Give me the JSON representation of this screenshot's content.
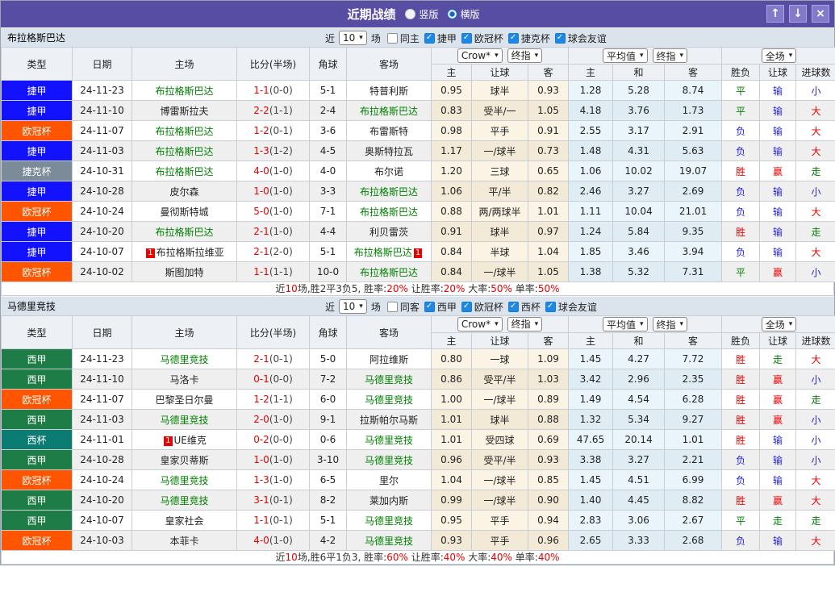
{
  "titlebar": {
    "title": "近期战绩",
    "radios": [
      {
        "label": "竖版",
        "selected": false
      },
      {
        "label": "横版",
        "selected": true
      }
    ],
    "buttons": {
      "up": "↑",
      "down": "↓",
      "close": "×"
    }
  },
  "colors": {
    "accent": "#574da3",
    "leagues": {
      "捷甲": "#1212ff",
      "欧冠杯": "#ff5400",
      "捷克杯": "#7c8b99",
      "西甲": "#1e7c46",
      "西杯": "#0b7c72"
    },
    "words": {
      "胜": "#ee0000",
      "赢": "#ee0000",
      "大": "#ee0000",
      "平": "#008000",
      "走": "#008000",
      "负": "#2222dd",
      "输": "#2222dd",
      "小": "#2222dd"
    }
  },
  "sections": [
    {
      "team": "布拉格斯巴达",
      "filter": {
        "near_label": "近",
        "count": "10",
        "matches_label": "场",
        "same": {
          "label": "同主",
          "checked": false
        },
        "leagues": [
          {
            "label": "捷甲",
            "checked": true
          },
          {
            "label": "欧冠杯",
            "checked": true
          },
          {
            "label": "捷克杯",
            "checked": true
          },
          {
            "label": "球会友谊",
            "checked": true
          }
        ]
      },
      "selects": {
        "book": "Crow*",
        "book_ref": "终指",
        "avg": "平均值",
        "avg_ref": "终指",
        "full": "全场"
      },
      "headers": [
        "类型",
        "日期",
        "主场",
        "比分(半场)",
        "角球",
        "客场"
      ],
      "sub_headers": [
        "主",
        "让球",
        "客",
        "主",
        "和",
        "客",
        "胜负",
        "让球",
        "进球数"
      ],
      "rows": [
        {
          "league": "捷甲",
          "date": "24-11-23",
          "home": "布拉格斯巴达",
          "home_hl": true,
          "home_rc": 0,
          "ft": "1-1",
          "ht": "(0-0)",
          "corner": "5-1",
          "away": "特普利斯",
          "away_hl": false,
          "away_rc": 0,
          "hcap": [
            "0.95",
            "球半",
            "0.93"
          ],
          "avg": [
            "1.28",
            "5.28",
            "8.74"
          ],
          "result": [
            "平",
            "输",
            "小"
          ]
        },
        {
          "league": "捷甲",
          "date": "24-11-10",
          "home": "博雷斯拉夫",
          "home_hl": false,
          "home_rc": 0,
          "ft": "2-2",
          "ht": "(1-1)",
          "corner": "2-4",
          "away": "布拉格斯巴达",
          "away_hl": true,
          "away_rc": 0,
          "hcap": [
            "0.83",
            "受半/一",
            "1.05"
          ],
          "avg": [
            "4.18",
            "3.76",
            "1.73"
          ],
          "result": [
            "平",
            "输",
            "大"
          ]
        },
        {
          "league": "欧冠杯",
          "date": "24-11-07",
          "home": "布拉格斯巴达",
          "home_hl": true,
          "home_rc": 0,
          "ft": "1-2",
          "ht": "(0-1)",
          "corner": "3-6",
          "away": "布雷斯特",
          "away_hl": false,
          "away_rc": 0,
          "hcap": [
            "0.98",
            "平手",
            "0.91"
          ],
          "avg": [
            "2.55",
            "3.17",
            "2.91"
          ],
          "result": [
            "负",
            "输",
            "大"
          ]
        },
        {
          "league": "捷甲",
          "date": "24-11-03",
          "home": "布拉格斯巴达",
          "home_hl": true,
          "home_rc": 0,
          "ft": "1-3",
          "ht": "(1-2)",
          "corner": "4-5",
          "away": "奥斯特拉瓦",
          "away_hl": false,
          "away_rc": 0,
          "hcap": [
            "1.17",
            "一/球半",
            "0.73"
          ],
          "avg": [
            "1.48",
            "4.31",
            "5.63"
          ],
          "result": [
            "负",
            "输",
            "大"
          ]
        },
        {
          "league": "捷克杯",
          "date": "24-10-31",
          "home": "布拉格斯巴达",
          "home_hl": true,
          "home_rc": 0,
          "ft": "4-0",
          "ht": "(1-0)",
          "corner": "4-0",
          "away": "布尔诺",
          "away_hl": false,
          "away_rc": 0,
          "hcap": [
            "1.20",
            "三球",
            "0.65"
          ],
          "avg": [
            "1.06",
            "10.02",
            "19.07"
          ],
          "result": [
            "胜",
            "赢",
            "走"
          ]
        },
        {
          "league": "捷甲",
          "date": "24-10-28",
          "home": "皮尔森",
          "home_hl": false,
          "home_rc": 0,
          "ft": "1-0",
          "ht": "(1-0)",
          "corner": "3-3",
          "away": "布拉格斯巴达",
          "away_hl": true,
          "away_rc": 0,
          "hcap": [
            "1.06",
            "平/半",
            "0.82"
          ],
          "avg": [
            "2.46",
            "3.27",
            "2.69"
          ],
          "result": [
            "负",
            "输",
            "小"
          ]
        },
        {
          "league": "欧冠杯",
          "date": "24-10-24",
          "home": "曼彻斯特城",
          "home_hl": false,
          "home_rc": 0,
          "ft": "5-0",
          "ht": "(1-0)",
          "corner": "7-1",
          "away": "布拉格斯巴达",
          "away_hl": true,
          "away_rc": 0,
          "hcap": [
            "0.88",
            "两/两球半",
            "1.01"
          ],
          "avg": [
            "1.11",
            "10.04",
            "21.01"
          ],
          "result": [
            "负",
            "输",
            "大"
          ]
        },
        {
          "league": "捷甲",
          "date": "24-10-20",
          "home": "布拉格斯巴达",
          "home_hl": true,
          "home_rc": 0,
          "ft": "2-1",
          "ht": "(1-0)",
          "corner": "4-4",
          "away": "利贝雷茨",
          "away_hl": false,
          "away_rc": 0,
          "hcap": [
            "0.91",
            "球半",
            "0.97"
          ],
          "avg": [
            "1.24",
            "5.84",
            "9.35"
          ],
          "result": [
            "胜",
            "输",
            "走"
          ]
        },
        {
          "league": "捷甲",
          "date": "24-10-07",
          "home": "布拉格斯拉维亚",
          "home_hl": false,
          "home_rc": 1,
          "ft": "2-1",
          "ht": "(2-0)",
          "corner": "5-1",
          "away": "布拉格斯巴达",
          "away_hl": true,
          "away_rc": 1,
          "hcap": [
            "0.84",
            "半球",
            "1.04"
          ],
          "avg": [
            "1.85",
            "3.46",
            "3.94"
          ],
          "result": [
            "负",
            "输",
            "大"
          ]
        },
        {
          "league": "欧冠杯",
          "date": "24-10-02",
          "home": "斯图加特",
          "home_hl": false,
          "home_rc": 0,
          "ft": "1-1",
          "ht": "(1-1)",
          "corner": "10-0",
          "away": "布拉格斯巴达",
          "away_hl": true,
          "away_rc": 0,
          "hcap": [
            "0.84",
            "一/球半",
            "1.05"
          ],
          "avg": [
            "1.38",
            "5.32",
            "7.31"
          ],
          "result": [
            "平",
            "赢",
            "小"
          ]
        }
      ],
      "summary": [
        {
          "t": "近"
        },
        {
          "t": "10",
          "red": true
        },
        {
          "t": "场,胜2平3负5, 胜率:"
        },
        {
          "t": "20%",
          "red": true
        },
        {
          "t": " 让胜率:"
        },
        {
          "t": "20%",
          "red": true
        },
        {
          "t": " 大率:"
        },
        {
          "t": "50%",
          "red": true
        },
        {
          "t": " 单率:"
        },
        {
          "t": "50%",
          "red": true
        }
      ]
    },
    {
      "team": "马德里竞技",
      "filter": {
        "near_label": "近",
        "count": "10",
        "matches_label": "场",
        "same": {
          "label": "同客",
          "checked": false
        },
        "leagues": [
          {
            "label": "西甲",
            "checked": true
          },
          {
            "label": "欧冠杯",
            "checked": true
          },
          {
            "label": "西杯",
            "checked": true
          },
          {
            "label": "球会友谊",
            "checked": true
          }
        ]
      },
      "selects": {
        "book": "Crow*",
        "book_ref": "终指",
        "avg": "平均值",
        "avg_ref": "终指",
        "full": "全场"
      },
      "headers": [
        "类型",
        "日期",
        "主场",
        "比分(半场)",
        "角球",
        "客场"
      ],
      "sub_headers": [
        "主",
        "让球",
        "客",
        "主",
        "和",
        "客",
        "胜负",
        "让球",
        "进球数"
      ],
      "rows": [
        {
          "league": "西甲",
          "date": "24-11-23",
          "home": "马德里竞技",
          "home_hl": true,
          "home_rc": 0,
          "ft": "2-1",
          "ht": "(0-1)",
          "corner": "5-0",
          "away": "阿拉维斯",
          "away_hl": false,
          "away_rc": 0,
          "hcap": [
            "0.80",
            "一球",
            "1.09"
          ],
          "avg": [
            "1.45",
            "4.27",
            "7.72"
          ],
          "result": [
            "胜",
            "走",
            "大"
          ]
        },
        {
          "league": "西甲",
          "date": "24-11-10",
          "home": "马洛卡",
          "home_hl": false,
          "home_rc": 0,
          "ft": "0-1",
          "ht": "(0-0)",
          "corner": "7-2",
          "away": "马德里竞技",
          "away_hl": true,
          "away_rc": 0,
          "hcap": [
            "0.86",
            "受平/半",
            "1.03"
          ],
          "avg": [
            "3.42",
            "2.96",
            "2.35"
          ],
          "result": [
            "胜",
            "赢",
            "小"
          ]
        },
        {
          "league": "欧冠杯",
          "date": "24-11-07",
          "home": "巴黎圣日尔曼",
          "home_hl": false,
          "home_rc": 0,
          "ft": "1-2",
          "ht": "(1-1)",
          "corner": "6-0",
          "away": "马德里竞技",
          "away_hl": true,
          "away_rc": 0,
          "hcap": [
            "1.00",
            "一/球半",
            "0.89"
          ],
          "avg": [
            "1.49",
            "4.54",
            "6.28"
          ],
          "result": [
            "胜",
            "赢",
            "走"
          ]
        },
        {
          "league": "西甲",
          "date": "24-11-03",
          "home": "马德里竞技",
          "home_hl": true,
          "home_rc": 0,
          "ft": "2-0",
          "ht": "(1-0)",
          "corner": "9-1",
          "away": "拉斯帕尔马斯",
          "away_hl": false,
          "away_rc": 0,
          "hcap": [
            "1.01",
            "球半",
            "0.88"
          ],
          "avg": [
            "1.32",
            "5.34",
            "9.27"
          ],
          "result": [
            "胜",
            "赢",
            "小"
          ]
        },
        {
          "league": "西杯",
          "date": "24-11-01",
          "home": "UE维克",
          "home_hl": false,
          "home_rc": 1,
          "ft": "0-2",
          "ht": "(0-0)",
          "corner": "0-6",
          "away": "马德里竞技",
          "away_hl": true,
          "away_rc": 0,
          "hcap": [
            "1.01",
            "受四球",
            "0.69"
          ],
          "avg": [
            "47.65",
            "20.14",
            "1.01"
          ],
          "result": [
            "胜",
            "输",
            "小"
          ]
        },
        {
          "league": "西甲",
          "date": "24-10-28",
          "home": "皇家贝蒂斯",
          "home_hl": false,
          "home_rc": 0,
          "ft": "1-0",
          "ht": "(1-0)",
          "corner": "3-10",
          "away": "马德里竞技",
          "away_hl": true,
          "away_rc": 0,
          "hcap": [
            "0.96",
            "受平/半",
            "0.93"
          ],
          "avg": [
            "3.38",
            "3.27",
            "2.21"
          ],
          "result": [
            "负",
            "输",
            "小"
          ]
        },
        {
          "league": "欧冠杯",
          "date": "24-10-24",
          "home": "马德里竞技",
          "home_hl": true,
          "home_rc": 0,
          "ft": "1-3",
          "ht": "(1-0)",
          "corner": "6-5",
          "away": "里尔",
          "away_hl": false,
          "away_rc": 0,
          "hcap": [
            "1.04",
            "一/球半",
            "0.85"
          ],
          "avg": [
            "1.45",
            "4.51",
            "6.99"
          ],
          "result": [
            "负",
            "输",
            "大"
          ]
        },
        {
          "league": "西甲",
          "date": "24-10-20",
          "home": "马德里竞技",
          "home_hl": true,
          "home_rc": 0,
          "ft": "3-1",
          "ht": "(0-1)",
          "corner": "8-2",
          "away": "莱加内斯",
          "away_hl": false,
          "away_rc": 0,
          "hcap": [
            "0.99",
            "一/球半",
            "0.90"
          ],
          "avg": [
            "1.40",
            "4.45",
            "8.82"
          ],
          "result": [
            "胜",
            "赢",
            "大"
          ]
        },
        {
          "league": "西甲",
          "date": "24-10-07",
          "home": "皇家社会",
          "home_hl": false,
          "home_rc": 0,
          "ft": "1-1",
          "ht": "(0-1)",
          "corner": "5-1",
          "away": "马德里竞技",
          "away_hl": true,
          "away_rc": 0,
          "hcap": [
            "0.95",
            "平手",
            "0.94"
          ],
          "avg": [
            "2.83",
            "3.06",
            "2.67"
          ],
          "result": [
            "平",
            "走",
            "走"
          ]
        },
        {
          "league": "欧冠杯",
          "date": "24-10-03",
          "home": "本菲卡",
          "home_hl": false,
          "home_rc": 0,
          "ft": "4-0",
          "ht": "(1-0)",
          "corner": "4-2",
          "away": "马德里竞技",
          "away_hl": true,
          "away_rc": 0,
          "hcap": [
            "0.93",
            "平手",
            "0.96"
          ],
          "avg": [
            "2.65",
            "3.33",
            "2.68"
          ],
          "result": [
            "负",
            "输",
            "大"
          ]
        }
      ],
      "summary": [
        {
          "t": "近"
        },
        {
          "t": "10",
          "red": true
        },
        {
          "t": "场,胜6平1负3, 胜率:"
        },
        {
          "t": "60%",
          "red": true
        },
        {
          "t": " 让胜率:"
        },
        {
          "t": "40%",
          "red": true
        },
        {
          "t": " 大率:"
        },
        {
          "t": "40%",
          "red": true
        },
        {
          "t": " 单率:"
        },
        {
          "t": "40%",
          "red": true
        }
      ]
    }
  ]
}
